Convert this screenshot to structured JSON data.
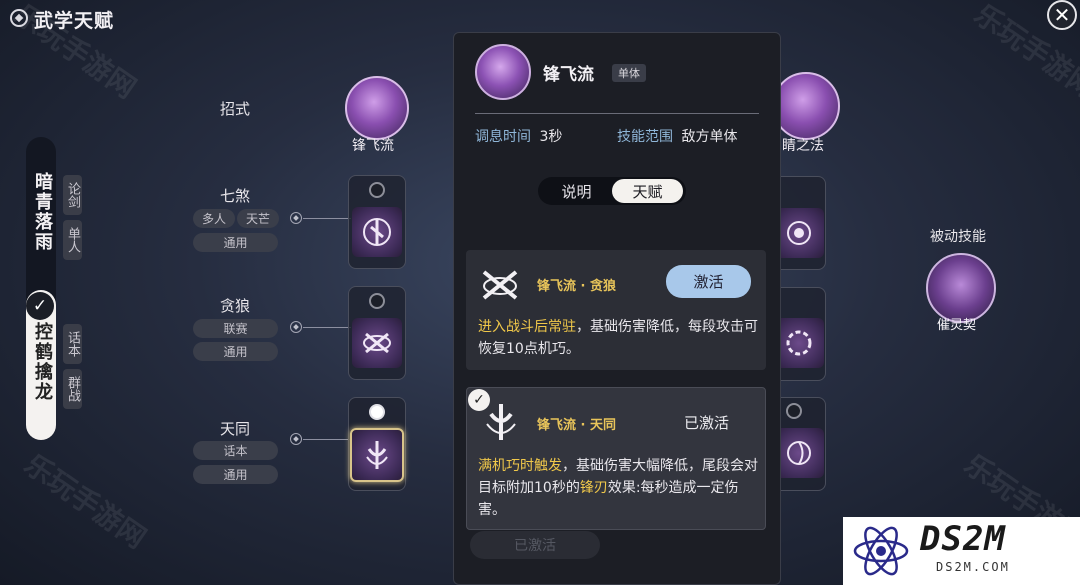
{
  "header": {
    "title": "武学天赋"
  },
  "watermarks": [
    "乐玩手游网",
    "乐玩手游网",
    "乐玩手游网",
    "乐玩手游网"
  ],
  "schools": [
    {
      "name": "暗青落雨",
      "tags": [
        "论剑",
        "单人"
      ],
      "selected": false
    },
    {
      "name": "控鹤擒龙",
      "tags": [
        "话本",
        "群战"
      ],
      "selected": true
    }
  ],
  "rows": {
    "header_label": "招式",
    "items": [
      {
        "label": "七煞",
        "tags": [
          "多人",
          "天芒"
        ],
        "sub": "通用"
      },
      {
        "label": "贪狼",
        "tags": [
          "联赛"
        ],
        "sub": "通用"
      },
      {
        "label": "天同",
        "tags": [
          "话本"
        ],
        "sub": "通用"
      }
    ]
  },
  "columns": {
    "left_skill": "锋飞流",
    "right_skill_partial": "睛之法"
  },
  "panel": {
    "skill_name": "锋飞流",
    "badge": "单体",
    "cooldown_label": "调息时间",
    "cooldown_value": "3秒",
    "range_label": "技能范围",
    "range_value": "敌方单体",
    "toggle": [
      "说明",
      "天赋"
    ],
    "toggle_active": "天赋",
    "talents": [
      {
        "title": "锋飞流 · 贪狼",
        "desc_hl": "进入战斗后常驻",
        "desc_rest": "，基础伤害降低，每段攻击可恢复10点机巧。",
        "button": "激活"
      },
      {
        "title": "锋飞流 · 天同",
        "status": "已激活",
        "desc_hl": "满机巧时触发",
        "desc_mid": "，基础伤害大幅降低，尾段会对目标附加10秒的",
        "desc_hl2": "锋刃",
        "desc_end": "效果:每秒造成一定伤害。"
      }
    ],
    "faded_button": "已激活"
  },
  "passive": {
    "label": "被动技能",
    "name": "催灵契"
  },
  "logo": {
    "main": "DS2M",
    "sub": "DS2M.COM"
  },
  "colors": {
    "accent_gold": "#f0c84a",
    "button_blue": "#a8c8ea",
    "skill_purple": "#8a4fb0"
  }
}
